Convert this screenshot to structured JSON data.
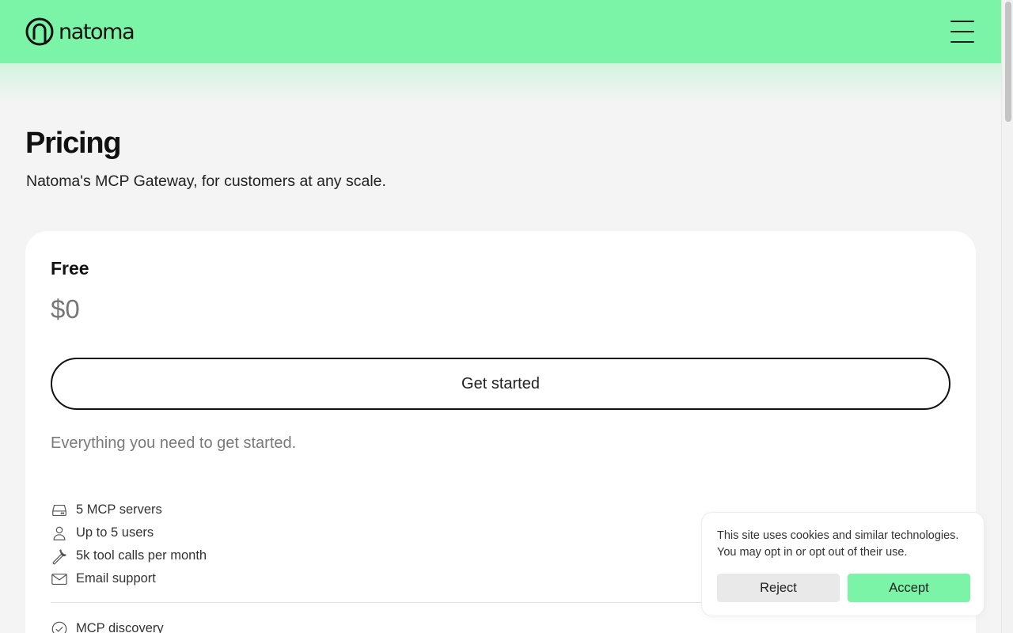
{
  "header": {
    "brand": "natoma",
    "accent_color": "#7cf4a8",
    "menu_icon": "hamburger-menu-icon"
  },
  "page": {
    "title": "Pricing",
    "subtitle": "Natoma's MCP Gateway, for customers at any scale."
  },
  "plan": {
    "name": "Free",
    "price": "$0",
    "cta_label": "Get started",
    "description": "Everything you need to get started.",
    "features": [
      {
        "icon": "server-icon",
        "label": "5 MCP servers"
      },
      {
        "icon": "user-icon",
        "label": "Up to 5 users"
      },
      {
        "icon": "wrench-icon",
        "label": "5k tool calls per month"
      },
      {
        "icon": "mail-icon",
        "label": "Email support"
      }
    ],
    "extras": [
      {
        "icon": "check-circle-icon",
        "label": "MCP discovery"
      }
    ]
  },
  "cookie_banner": {
    "message": "This site uses cookies and similar technologies. You may opt in or opt out of their use.",
    "reject_label": "Reject",
    "accept_label": "Accept"
  }
}
